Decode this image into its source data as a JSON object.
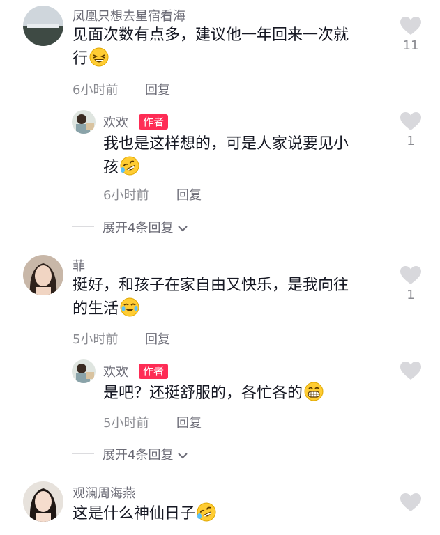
{
  "comments": [
    {
      "username": "凤凰只想去星宿看海",
      "text_line1": "见面次数有点多，建议他一年回来一次就",
      "text_line2": "行",
      "time": "6小时前",
      "reply_label": "回复",
      "like_count": "11",
      "emoji": "laughing-emoji",
      "reply": {
        "username": "欢欢",
        "badge": "作者",
        "text_line1": "我也是这样想的，可是人家说要见小",
        "text_line2": "孩",
        "time": "6小时前",
        "reply_label": "回复",
        "like_count": "1",
        "emoji": "rofl-emoji"
      },
      "expand_label": "展开4条回复"
    },
    {
      "username": "菲",
      "text_line1": "挺好，和孩子在家自由又快乐，是我向往",
      "text_line2": "的生活",
      "time": "5小时前",
      "reply_label": "回复",
      "like_count": "1",
      "emoji": "tears-of-joy-emoji",
      "reply": {
        "username": "欢欢",
        "badge": "作者",
        "text_line1": "是吧？还挺舒服的，各忙各的",
        "time": "5小时前",
        "reply_label": "回复",
        "like_count": "",
        "emoji": "grin-emoji"
      },
      "expand_label": "展开4条回复"
    },
    {
      "username": "观澜周海燕",
      "text_line1": "这是什么神仙日子",
      "like_count": "",
      "emoji": "rofl-emoji"
    }
  ],
  "colors": {
    "author_badge": "#fe2c55",
    "text": "#161823",
    "muted": "#8a8b91",
    "heart": "#d8d8dc"
  }
}
